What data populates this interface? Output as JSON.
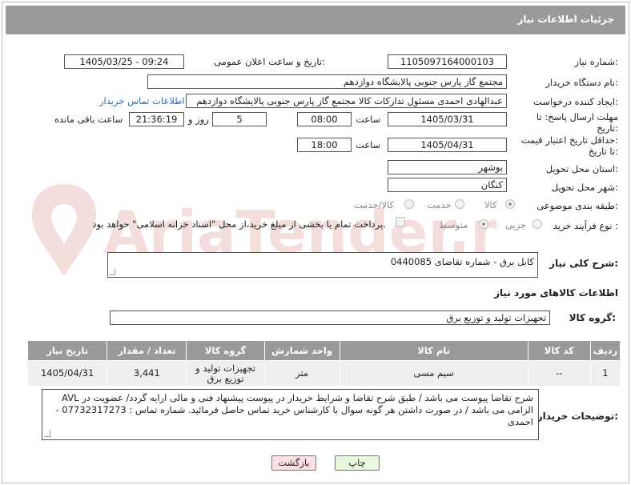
{
  "header": {
    "title": "جزئیات اطلاعات نیاز"
  },
  "fields": {
    "need_number_label": "شماره نیاز:",
    "need_number": "1105097164000103",
    "announce_label": "تاریخ و ساعت اعلان عمومی:",
    "announce_value": "1405/03/25 - 09:24",
    "buyer_label": "نام دستگاه خریدار:",
    "buyer_value": "مجتمع گاز پارس جنوبی  پالایشگاه دوازدهم",
    "creator_label": "ایجاد کننده درخواست:",
    "creator_value": "عبدالهادی احمدی مسئول تدارکات کالا مجتمع گاز پارس جنوبی  پالایشگاه دوازدهم",
    "contact_link": "اطلاعات تماس خریدار",
    "deadline_label_1": "مهلت ارسال پاسخ: تا",
    "deadline_label_2": "تاریخ:",
    "deadline_date": "1405/03/31",
    "time_label": "ساعت",
    "deadline_time": "08:00",
    "days_value": "5",
    "days_label": "روز و",
    "remaining_time": "21:36:19",
    "remaining_label": "ساعت باقی مانده",
    "validity_label_1": "حداقل تاریخ اعتبار قیمت:",
    "validity_label_2": "تا تاریخ:",
    "validity_date": "1405/04/31",
    "validity_time": "18:00",
    "province_label": "استان محل تحویل:",
    "province_value": "بوشهر",
    "city_label": "شهر محل تحویل:",
    "city_value": "کنگان",
    "category_label": "طبقه بندی موضوعی:",
    "category_options": [
      "کالا",
      "خدمت",
      "کالا/خدمت"
    ],
    "process_label": "نوع فرآیند خرید :",
    "process_options": [
      "جزیی",
      "متوسط"
    ],
    "payment_note": "پرداخت تمام یا بخشی از مبلغ خرید،از محل \"اسناد خزانه اسلامی\" خواهد بود.",
    "summary_label": "شرح کلی نیاز:",
    "summary_value": "کابل برق - شماره تقاضای 0440085",
    "items_info_label": "اطلاعات کالاهای مورد نیاز",
    "group_label": "گروه کالا:",
    "group_value": "تجهیزات تولید و توزیع برق"
  },
  "table": {
    "headers": [
      "ردیف",
      "کد کالا",
      "نام کالا",
      "واحد شمارش",
      "گروه کالا",
      "تعداد / مقدار",
      "تاریخ نیاز"
    ],
    "rows": [
      [
        "1",
        "--",
        "سیم مسی",
        "متر",
        "تجهیزات تولید و توزیع برق",
        "3,441",
        "1405/04/31"
      ]
    ]
  },
  "buyer_notes": {
    "label": "توضیحات خریدار:",
    "text": "شرح تقاضا پیوست می باشد / طبق شرح تقاضا و شرایط خریدار در پیوست پیشنهاد فنی و مالی ارایه گردد/ عضویت در AVL الزامی می باشد / در صورت داشتن هر گونه سوال با کارشناس خرید تماس حاصل فرمائید. شماره تماس : 07732317273 - احمدی"
  },
  "buttons": {
    "print": "چاپ",
    "back": "بازگشت"
  },
  "watermark": {
    "text": "AriaTender.net"
  },
  "colors": {
    "header_bg": "#9a9a9a",
    "link": "#2a6ebb",
    "print_btn": "#e9f7df",
    "back_btn": "#fbe1e4",
    "watermark": "#c0392b"
  }
}
